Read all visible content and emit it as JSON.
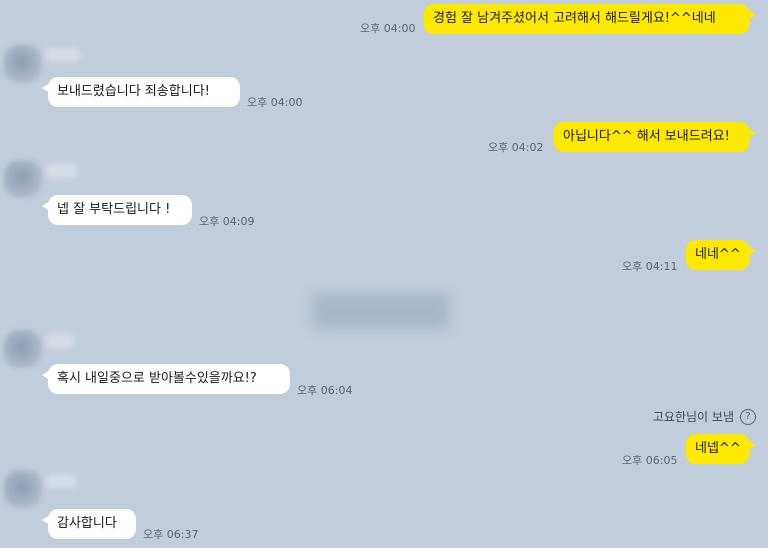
{
  "messages": [
    {
      "side": "out",
      "text": "경험 잘 남겨주셨어서 고려해서 해드릴게요!^^네네",
      "time": "오후 04:00"
    },
    {
      "side": "in",
      "text": "보내드렸습니다 죄송합니다!",
      "time": "오후 04:00"
    },
    {
      "side": "out",
      "text": "아닙니다^^ 해서 보내드려요!",
      "time": "오후 04:02"
    },
    {
      "side": "in",
      "text": "넵 잘 부탁드립니다 !",
      "time": "오후 04:09"
    },
    {
      "side": "out",
      "text": "네네^^",
      "time": "오후 04:11"
    },
    {
      "side": "in",
      "text": "혹시 내일중으로 받아볼수있을까요!?",
      "time": "오후 06:04"
    },
    {
      "side": "out",
      "text": "네넵^^",
      "time": "오후 06:05"
    },
    {
      "side": "in",
      "text": "감사합니다",
      "time": "오후 06:37"
    }
  ],
  "system_note": {
    "text": "고요한님이 보냄",
    "icon": "question-circle-icon"
  },
  "colors": {
    "background": "#c2cddb",
    "outgoing_bubble": "#fde800",
    "incoming_bubble": "#ffffff"
  }
}
